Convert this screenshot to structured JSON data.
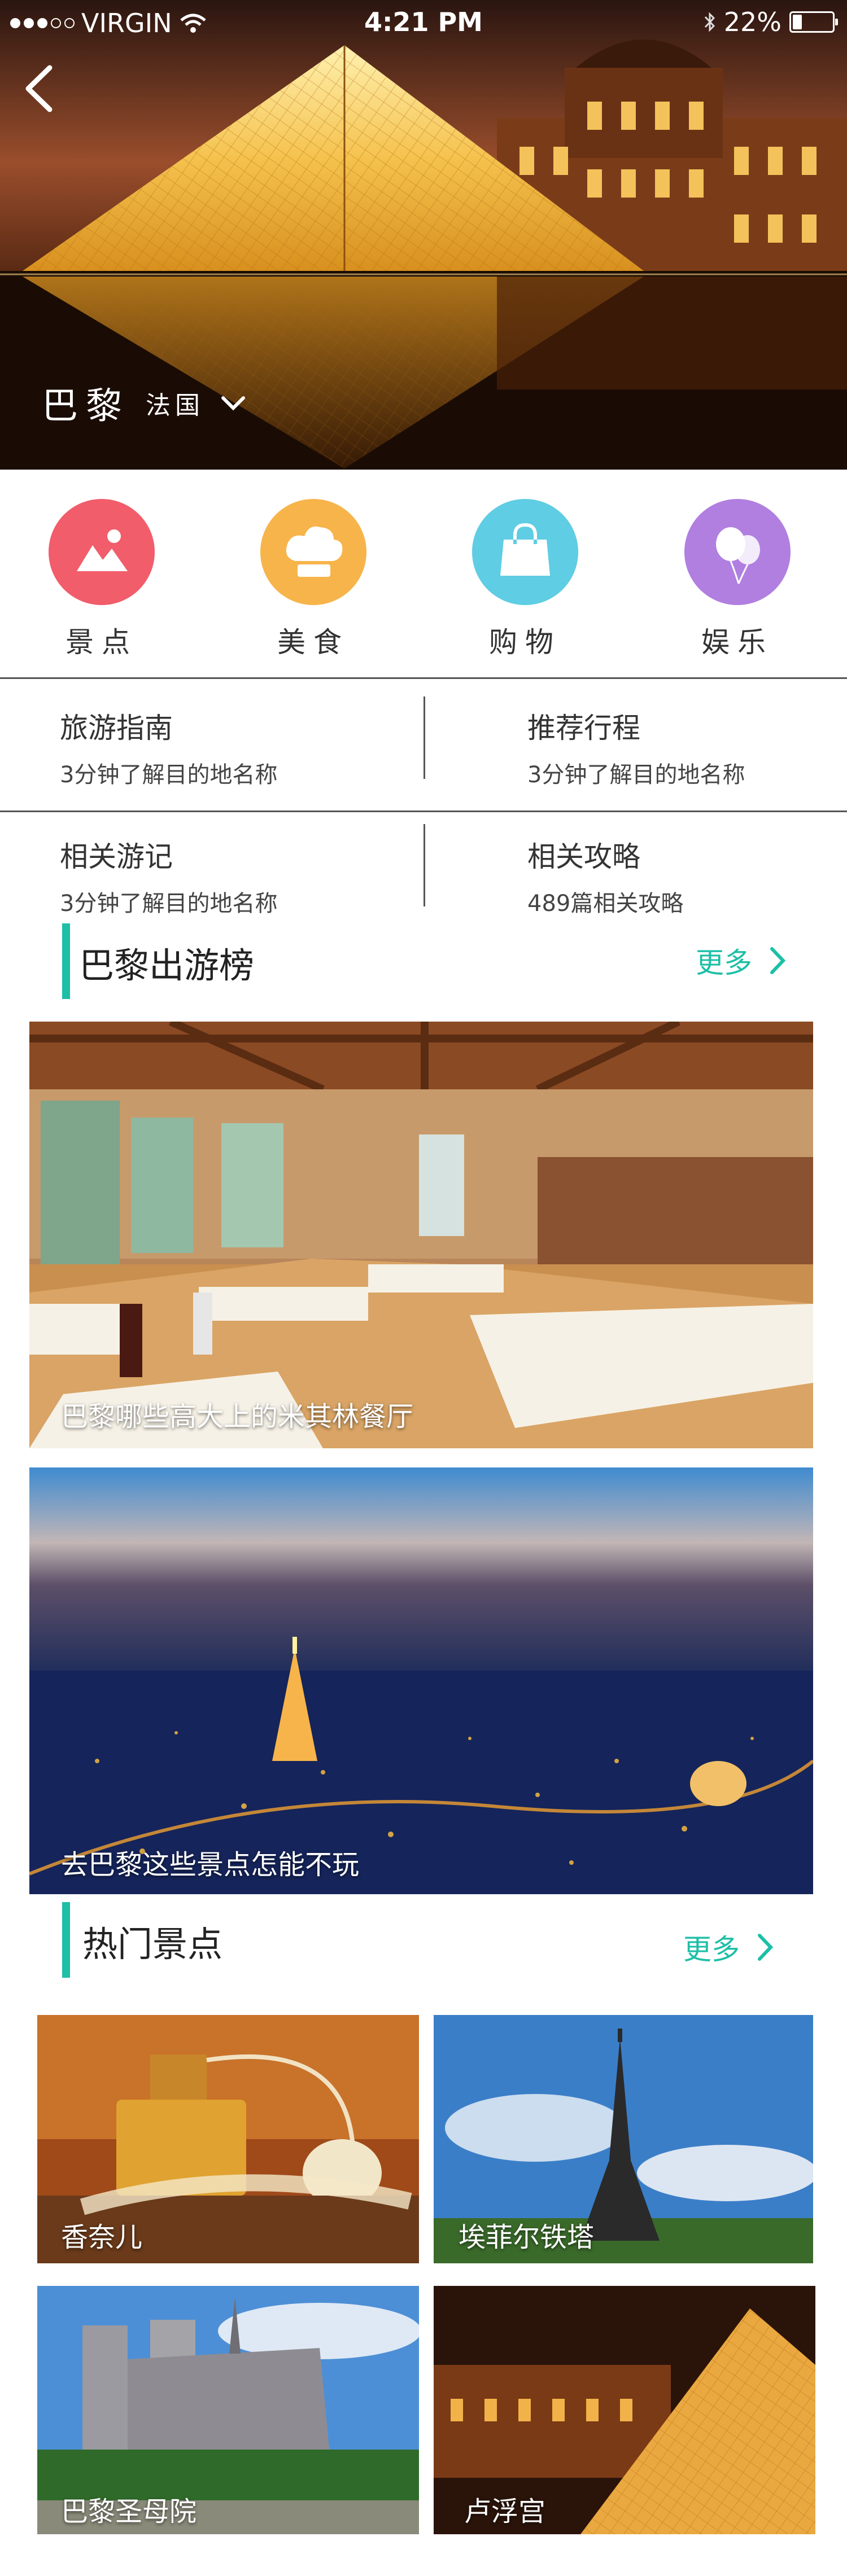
{
  "status_bar": {
    "carrier": "VIRGIN",
    "time": "4:21 PM",
    "battery": "22%"
  },
  "header": {
    "city": "巴黎",
    "country": "法国"
  },
  "categories": [
    {
      "label": "景点",
      "color": "#f15d6a",
      "icon": "image-icon"
    },
    {
      "label": "美食",
      "color": "#f7b44a",
      "icon": "chef-hat-icon"
    },
    {
      "label": "购物",
      "color": "#5fcde3",
      "icon": "shopping-bag-icon"
    },
    {
      "label": "娱乐",
      "color": "#b07fe0",
      "icon": "balloon-icon"
    }
  ],
  "info": [
    {
      "title": "旅游指南",
      "sub": "3分钟了解目的地名称"
    },
    {
      "title": "推荐行程",
      "sub": "3分钟了解目的地名称"
    },
    {
      "title": "相关游记",
      "sub": "3分钟了解目的地名称"
    },
    {
      "title": "相关攻略",
      "sub": "489篇相关攻略"
    }
  ],
  "ranking": {
    "title": "巴黎出游榜",
    "more": "更多",
    "items": [
      {
        "caption": "巴黎哪些高大上的米其林餐厅"
      },
      {
        "caption": "去巴黎这些景点怎能不玩"
      }
    ]
  },
  "hot": {
    "title": "热门景点",
    "more": "更多",
    "items": [
      {
        "caption": "香奈儿"
      },
      {
        "caption": "埃菲尔铁塔"
      },
      {
        "caption": "巴黎圣母院"
      },
      {
        "caption": "卢浮宫"
      }
    ]
  },
  "colors": {
    "accent": "#1dbfa6"
  }
}
